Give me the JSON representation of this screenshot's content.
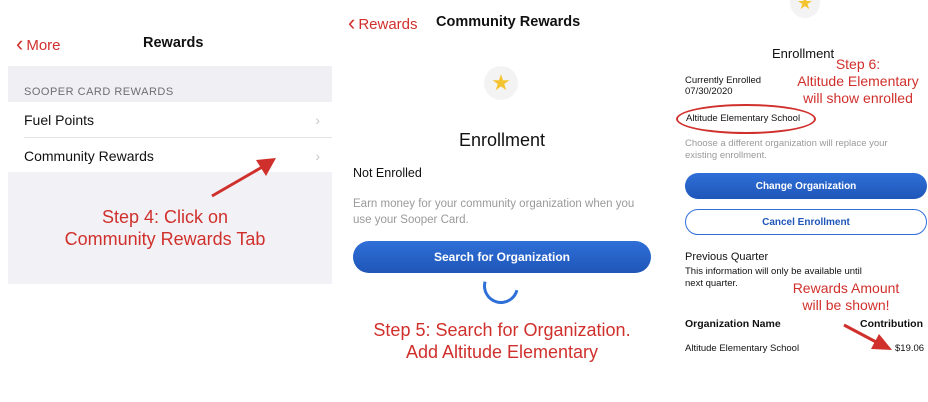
{
  "panel1": {
    "back_label": "More",
    "title": "Rewards",
    "section_header": "SOOPER CARD REWARDS",
    "items": [
      {
        "label": "Fuel Points"
      },
      {
        "label": "Community Rewards"
      }
    ],
    "annotation": [
      "Step 4: Click on",
      "Community Rewards Tab"
    ]
  },
  "panel2": {
    "back_label": "Rewards",
    "title": "Community Rewards",
    "heading": "Enrollment",
    "status": "Not Enrolled",
    "description": "Earn money for your community organization when you use your Sooper Card.",
    "search_button": "Search for Organization",
    "annotation": [
      "Step 5: Search for Organization.",
      "Add Altitude Elementary"
    ]
  },
  "panel3": {
    "heading": "Enrollment",
    "enrolled_label": "Currently Enrolled",
    "enrolled_date": "07/30/2020",
    "organization": "Altitude Elementary School",
    "replace_note": "Choose a different organization will replace your existing enrollment.",
    "change_button": "Change Organization",
    "cancel_button": "Cancel Enrollment",
    "previous_quarter": "Previous Quarter",
    "availability_note": "This information will only be available until next quarter.",
    "col_org": "Organization Name",
    "col_contribution": "Contribution",
    "row_org": "Altitude Elementary School",
    "row_amount": "$19.06",
    "annotation_step6": [
      "Step 6:",
      "Altitude Elementary",
      "will show enrolled"
    ],
    "annotation_rewards": [
      "Rewards Amount",
      "will be shown!"
    ]
  },
  "colors": {
    "annotation_red": "#d0302c",
    "button_blue": "#2f6fd8",
    "star_yellow": "#f4c430"
  },
  "icons": [
    "chevron-left-icon",
    "chevron-right-icon",
    "star-icon",
    "loading-spinner"
  ]
}
